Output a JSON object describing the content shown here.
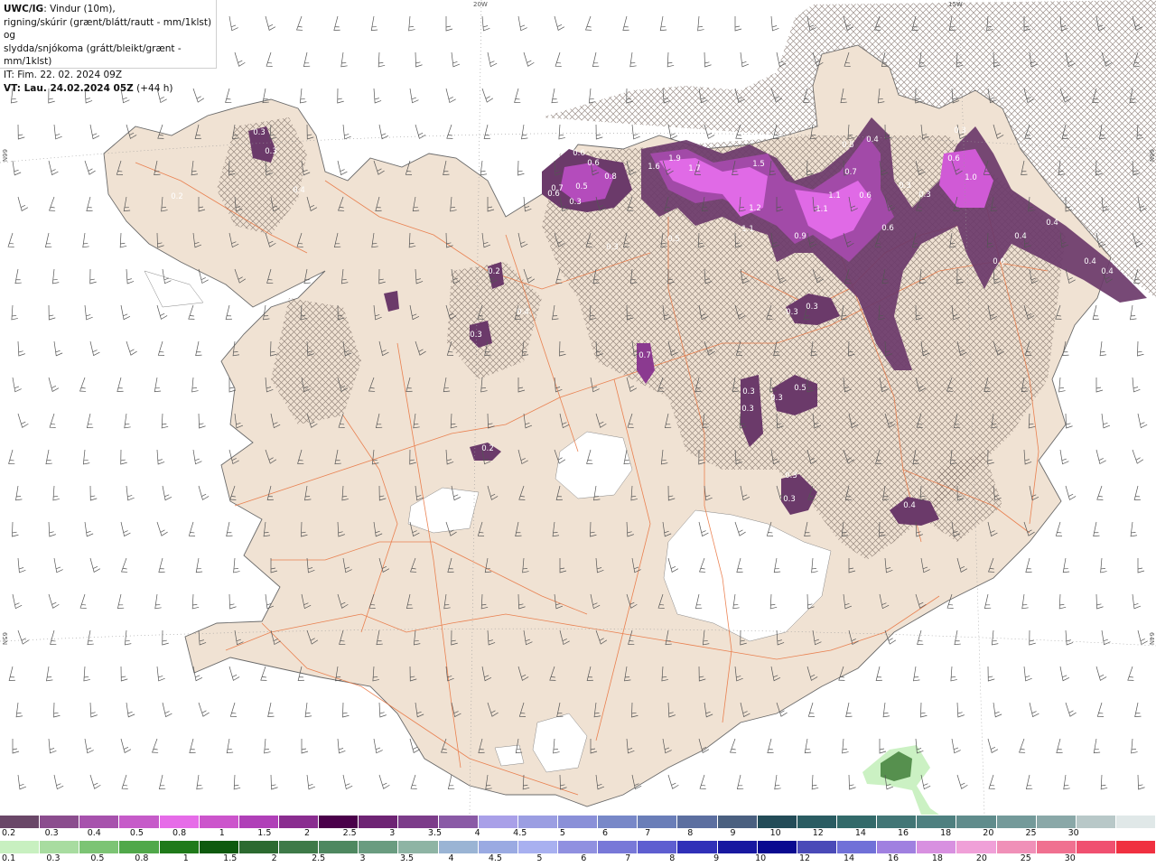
{
  "header": {
    "model": "UWC/IG",
    "line1_rest": ": Vindur (10m),",
    "line2": "rigning/skúrir (grænt/blátt/rautt - mm/1klst) og",
    "line3": "slydda/snjókoma (grátt/bleikt/grænt - mm/1klst)",
    "line4": "IT: Fim. 22. 02. 2024 09Z",
    "line5_bold": "VT: Lau. 24.02.2024 05Z",
    "line5_rest": " (+44 h)"
  },
  "coords": {
    "top_a": "20W",
    "top_b": "15W",
    "left_a": "66N",
    "left_b": "65N",
    "right_a": "66N",
    "right_b": "64N"
  },
  "map_labels": [
    {
      "text": "0.3"
    },
    {
      "text": "0.4"
    },
    {
      "text": "0.2"
    },
    {
      "text": "0.3"
    },
    {
      "text": "1.6"
    },
    {
      "text": "1.9"
    },
    {
      "text": "1.7"
    },
    {
      "text": "1.5"
    },
    {
      "text": "1.2"
    },
    {
      "text": "1.1"
    },
    {
      "text": "0.9"
    },
    {
      "text": "1.1"
    },
    {
      "text": "1.1"
    },
    {
      "text": "0.7"
    },
    {
      "text": "0.6"
    },
    {
      "text": "0.6"
    },
    {
      "text": "0.5"
    },
    {
      "text": "0.4"
    },
    {
      "text": "0.3"
    },
    {
      "text": "0.3"
    },
    {
      "text": "0.3"
    },
    {
      "text": "1.0"
    },
    {
      "text": "0.4"
    },
    {
      "text": "0.4"
    },
    {
      "text": "0.6"
    },
    {
      "text": "0.4"
    },
    {
      "text": "0.4"
    },
    {
      "text": "0.6"
    },
    {
      "text": "0.6"
    },
    {
      "text": "0.8"
    },
    {
      "text": "0.6"
    },
    {
      "text": "0.3"
    },
    {
      "text": "0.5"
    },
    {
      "text": "0.3"
    },
    {
      "text": "0.7"
    },
    {
      "text": "0.3"
    },
    {
      "text": "0.3"
    },
    {
      "text": "0.2"
    },
    {
      "text": "0.5"
    },
    {
      "text": "0.3"
    },
    {
      "text": "0.3"
    },
    {
      "text": "0.3"
    },
    {
      "text": "0.3"
    },
    {
      "text": "0.3"
    },
    {
      "text": "0.4"
    },
    {
      "text": "0.4"
    },
    {
      "text": "0.2"
    },
    {
      "text": "0.3"
    },
    {
      "text": "0.7"
    },
    {
      "text": "0.5"
    },
    {
      "text": "0.6"
    }
  ],
  "legend_snow": {
    "colors": [
      "#6a4768",
      "#8b4d8e",
      "#a752ad",
      "#c65bc9",
      "#e66ce8",
      "#cc55cc",
      "#b040b8",
      "#8a2d90",
      "#4a004a",
      "#6e2474",
      "#7c3c8a",
      "#8a5aa6",
      "#a9a0e8",
      "#9b9ee2",
      "#8a90d8",
      "#7888c8",
      "#6a7eb8",
      "#5c6fa0",
      "#4a6080",
      "#234c58",
      "#2a5c62",
      "#336a6a",
      "#427676",
      "#4e8080",
      "#608c8c",
      "#749a9a",
      "#8aa8a8",
      "#b8c8c8",
      "#e0e8e8"
    ],
    "labels": [
      "0.2",
      "0.3",
      "0.4",
      "0.5",
      "0.8",
      "1",
      "1.5",
      "2",
      "2.5",
      "3",
      "3.5",
      "4",
      "4.5",
      "5",
      "6",
      "7",
      "8",
      "9",
      "10",
      "12",
      "14",
      "16",
      "18",
      "20",
      "25",
      "30"
    ]
  },
  "legend_rain": {
    "colors": [
      "#c8f0c0",
      "#a8dca0",
      "#7cc474",
      "#50a84a",
      "#1f7a1a",
      "#0e5a0e",
      "#2c6a30",
      "#3e7a48",
      "#4e8860",
      "#6a9c80",
      "#8eb4a4",
      "#9ab4d4",
      "#9aaae2",
      "#a8b0f0",
      "#9090e0",
      "#7878d8",
      "#5e5ed0",
      "#3030b8",
      "#1818a0",
      "#0a0a90",
      "#4a4ab8",
      "#7070d8",
      "#a080e0",
      "#d890e0",
      "#f0a0d8",
      "#f090b8",
      "#f07090",
      "#f05070",
      "#f03040"
    ],
    "labels": [
      "0.1",
      "0.3",
      "0.5",
      "0.8",
      "1",
      "1.5",
      "2",
      "2.5",
      "3",
      "3.5",
      "4",
      "4.5",
      "5",
      "6",
      "7",
      "8",
      "9",
      "10",
      "12",
      "14",
      "16",
      "18",
      "20",
      "25",
      "30"
    ]
  }
}
